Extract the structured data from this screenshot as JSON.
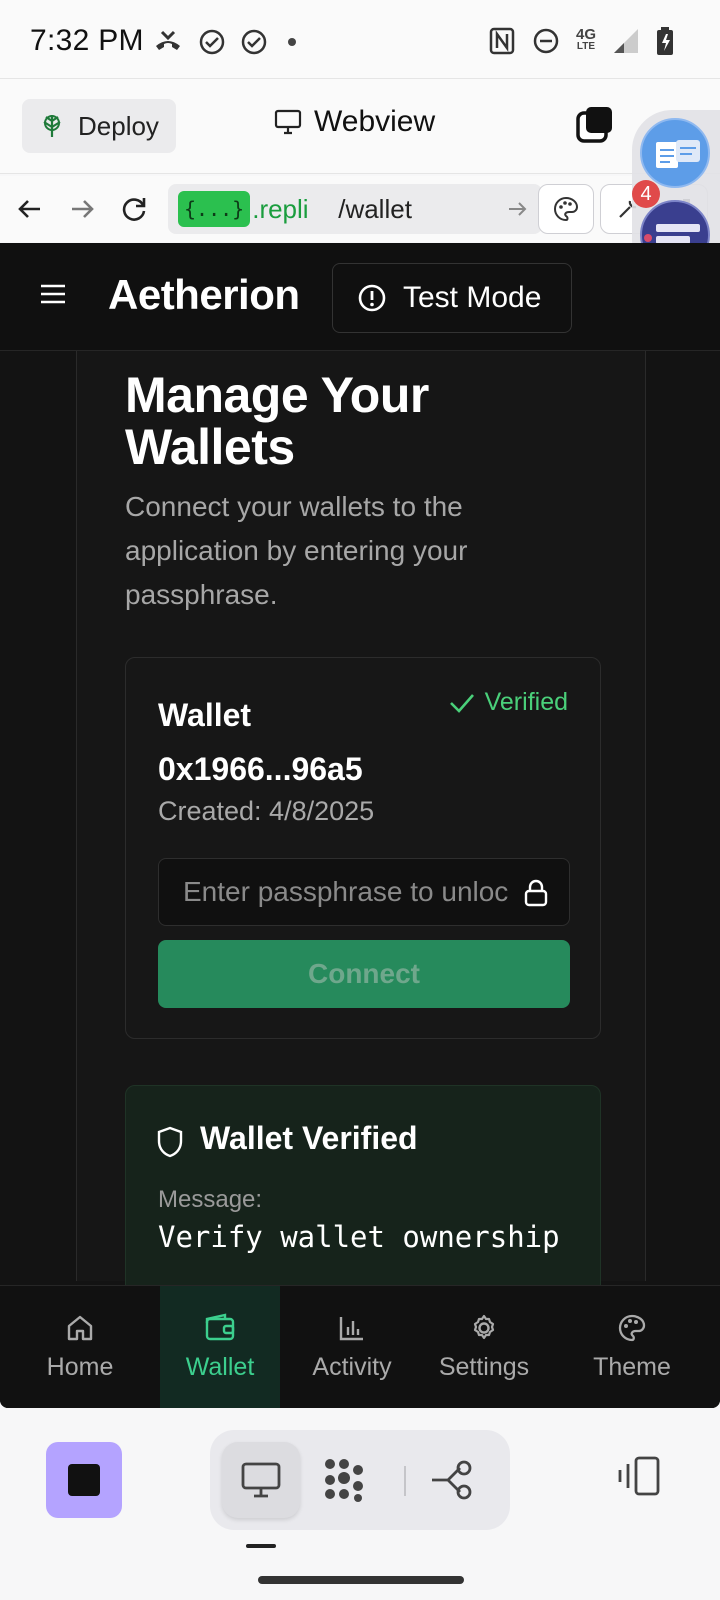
{
  "status_bar": {
    "time": "7:32 PM",
    "network": "4G",
    "network_sub": "LTE"
  },
  "replit_bar": {
    "deploy_label": "Deploy",
    "webview_label": "Webview",
    "notification_count": "4"
  },
  "url_bar": {
    "badge": "{...}",
    "host": ".repli",
    "path": "/wallet"
  },
  "app": {
    "brand": "Aetherion",
    "test_mode_label": "Test Mode",
    "page_title": "Manage Your Wallets",
    "page_subtitle": "Connect your wallets to the application by entering your passphrase.",
    "wallet_card": {
      "name": "Wallet 0x1966...96a5",
      "status": "Verified",
      "created": "Created: 4/8/2025",
      "passphrase_placeholder": "Enter passphrase to unlock",
      "connect_label": "Connect"
    },
    "verified_card": {
      "title": "Wallet Verified",
      "message_label": "Message:",
      "message": "Verify wallet ownership"
    },
    "bottom_nav": [
      {
        "label": "Home",
        "icon": "home-icon"
      },
      {
        "label": "Wallet",
        "icon": "wallet-icon",
        "active": true
      },
      {
        "label": "Activity",
        "icon": "bar-chart-icon"
      },
      {
        "label": "Settings",
        "icon": "gear-icon"
      },
      {
        "label": "Theme",
        "icon": "palette-icon"
      }
    ]
  },
  "colors": {
    "accent_green": "#3ccf8e",
    "connect_button": "#268a5c",
    "verified_text": "#4ad07a",
    "stop_button": "#b4a3ff",
    "app_background": "#131313"
  }
}
